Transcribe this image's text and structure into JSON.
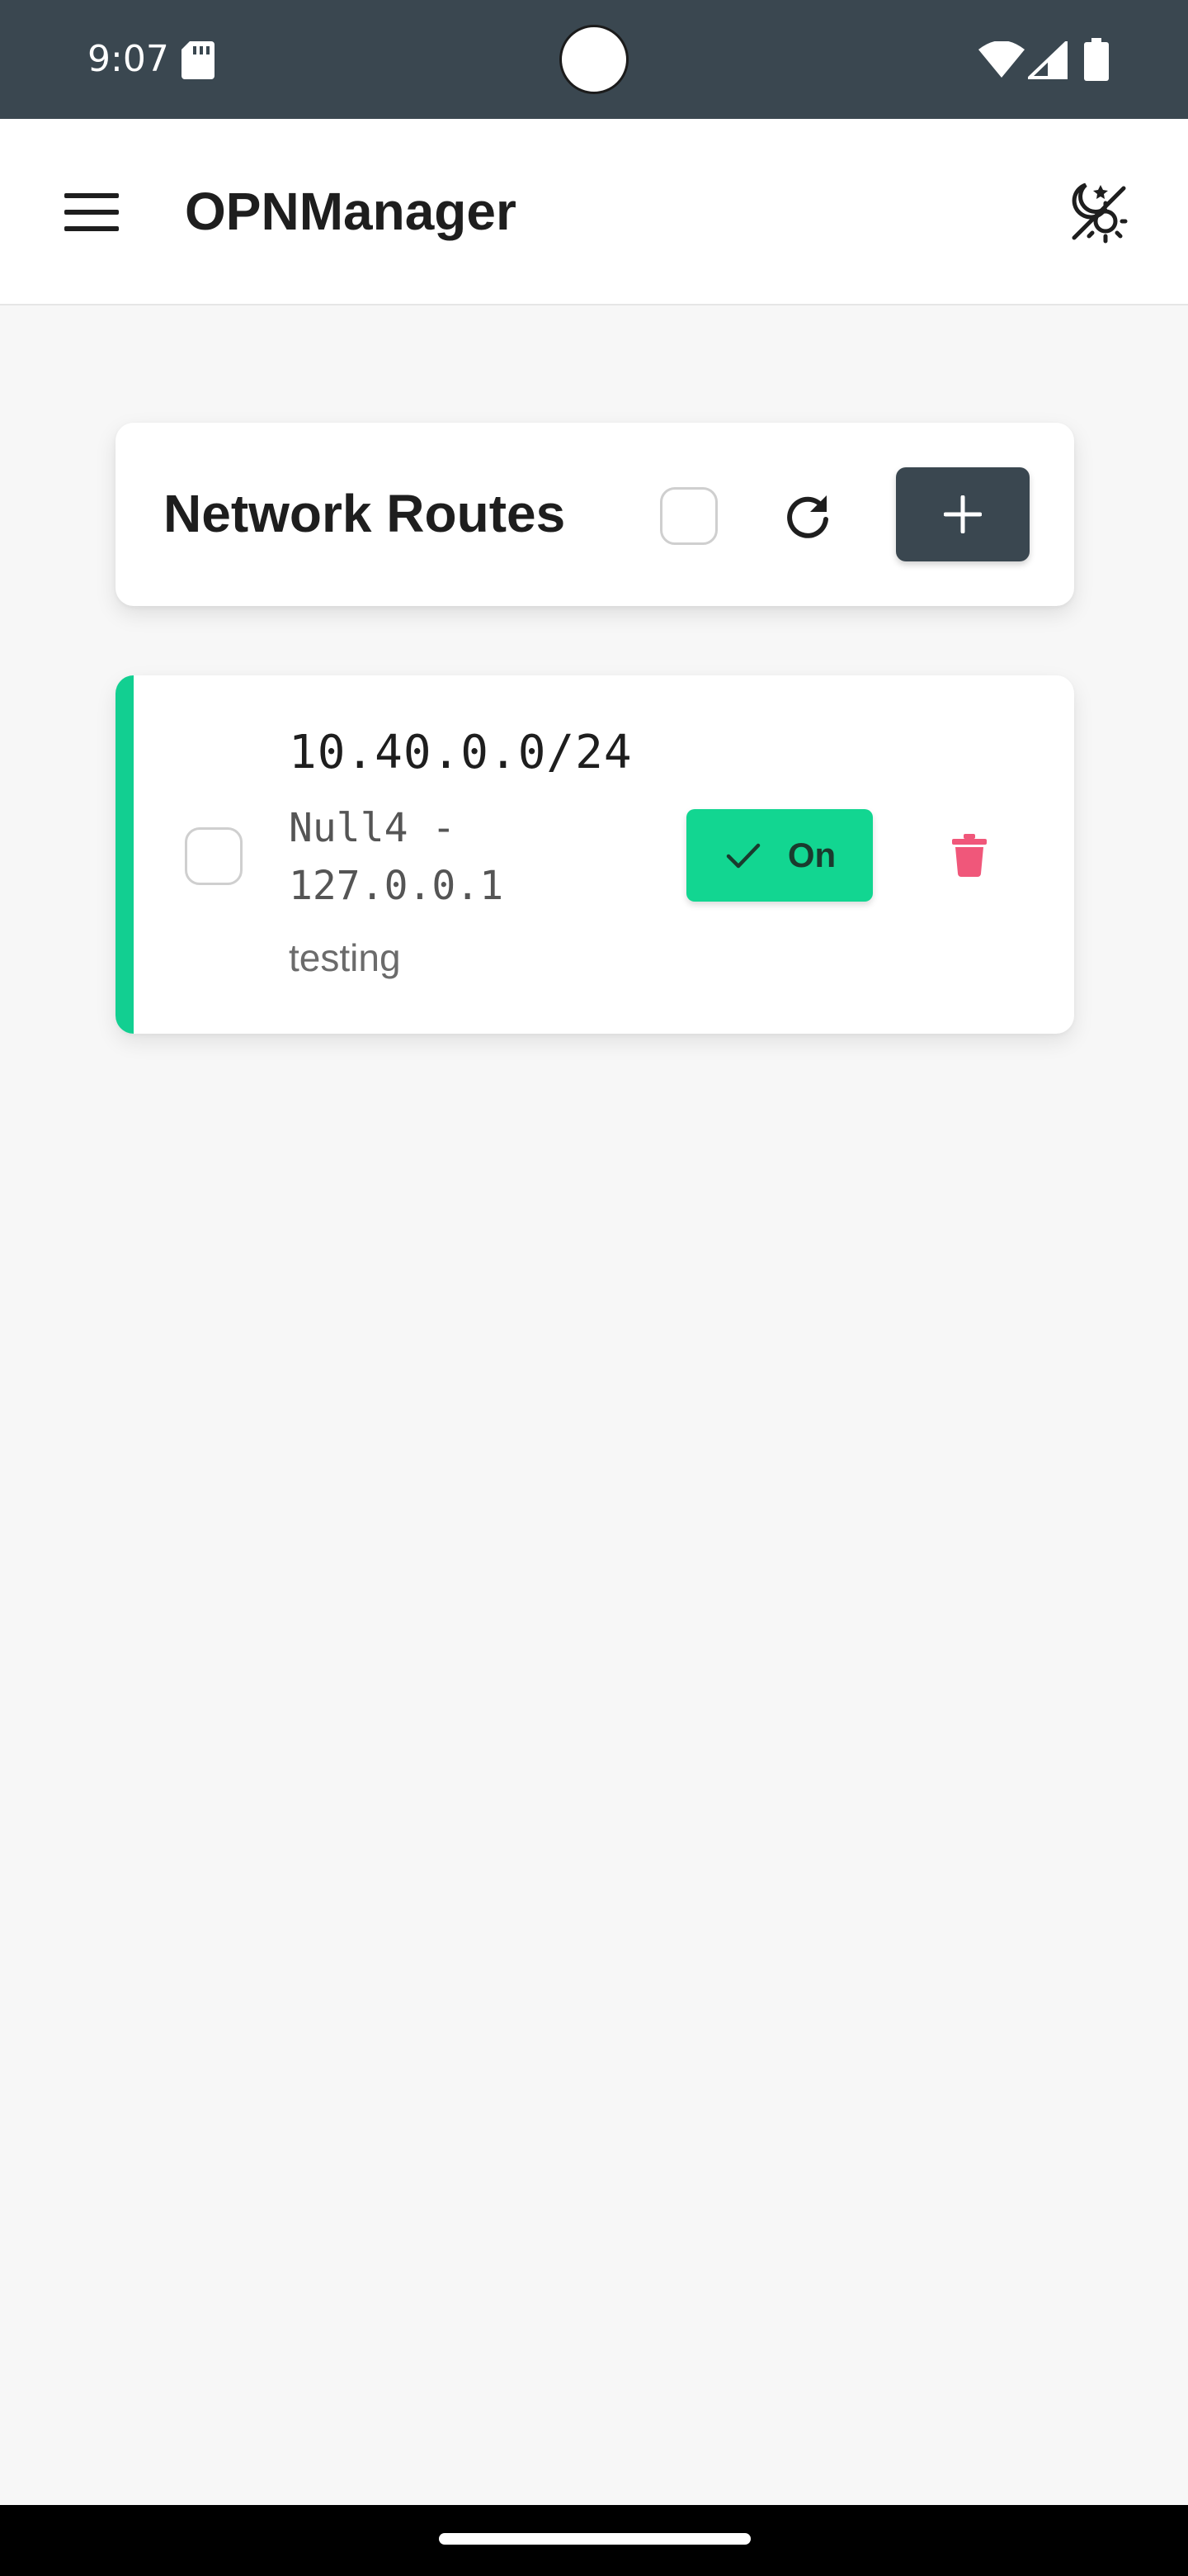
{
  "status_bar": {
    "time": "9:07",
    "icons": [
      "sd-card-icon",
      "wifi-icon",
      "signal-icon",
      "battery-icon"
    ]
  },
  "app_bar": {
    "title": "OPNManager",
    "icons": [
      "menu-icon",
      "theme-toggle-icon"
    ]
  },
  "header": {
    "title": "Network Routes",
    "icons": [
      "checkbox",
      "refresh-icon",
      "plus-icon"
    ]
  },
  "routes": [
    {
      "network": "10.40.0.0/24",
      "gateway": "Null4 - 127.0.0.1",
      "description": "testing",
      "status_label": "On",
      "enabled": true
    }
  ],
  "colors": {
    "primary_dark": "#3a4750",
    "accent_green": "#12d691",
    "delete_red": "#f0577a",
    "background": "#f7f7f7"
  }
}
